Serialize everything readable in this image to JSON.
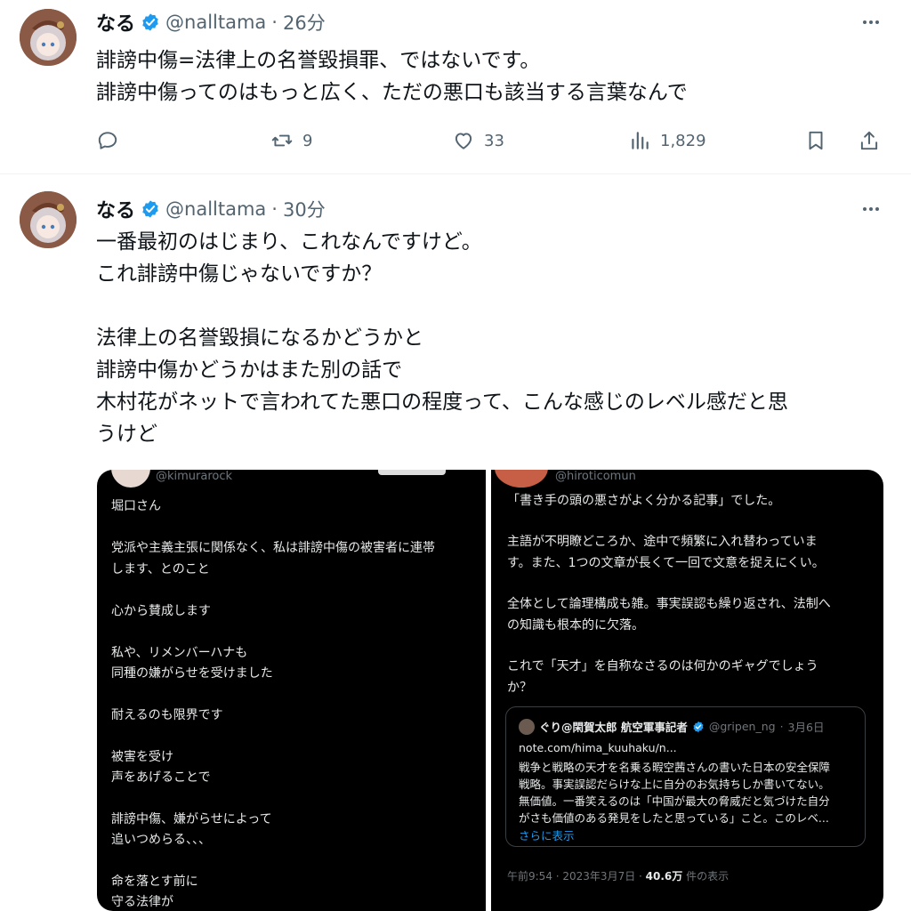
{
  "tweets": [
    {
      "name": "なる",
      "handle": "@nalltama",
      "separator": "·",
      "time": "26分",
      "lines": [
        "誹謗中傷=法律上の名誉毀損罪、ではないです。",
        "誹謗中傷ってのはもっと広く、ただの悪口も該当する言葉なんで"
      ],
      "actions": {
        "reply": "",
        "retweet": "9",
        "like": "33",
        "views": "1,829"
      }
    },
    {
      "name": "なる",
      "handle": "@nalltama",
      "separator": "·",
      "time": "30分",
      "lines": [
        "一番最初のはじまり、これなんですけど。",
        "これ誹謗中傷じゃないですか？",
        "",
        "法律上の名誉毀損になるかどうかと",
        "誹謗中傷かどうかはまた別の話で",
        "木村花がネットで言われてた悪口の程度って、こんな感じのレベル感だと思",
        "うけど"
      ]
    }
  ],
  "media": {
    "left": {
      "handle": "@kimurarock",
      "lines": [
        "堀口さん",
        "",
        "党派や主義主張に関係なく、私は誹謗中傷の被害者に連帯",
        "します、とのこと",
        "",
        "心から賛成します",
        "",
        "私や、リメンバーハナも",
        "同種の嫌がらせを受けました",
        "",
        "耐えるのも限界です",
        "",
        "被害を受け",
        "声をあげることで",
        "",
        "誹謗中傷、嫌がらせによって",
        "追いつめらる、、、",
        "",
        "命を落とす前に",
        "守る法律が"
      ]
    },
    "right": {
      "handle": "@hiroticomun",
      "lines": [
        "「書き手の頭の悪さがよく分かる記事」でした。",
        "",
        "主語が不明瞭どころか、途中で頻繁に入れ替わっていま",
        "す。また、1つの文章が長くて一回で文意を捉えにくい。",
        "",
        "全体として論理構成も雑。事実誤認も繰り返され、法制へ",
        "の知識も根本的に欠落。",
        "",
        "これで「天才」を自称なさるのは何かのギャグでしょう",
        "か？"
      ],
      "quote": {
        "name": "ぐり@閑賀太郎 航空軍事記者",
        "handle": "@gripen_ng",
        "separator": "·",
        "date": "3月6日",
        "lines": [
          "note.com/hima_kuuhaku/n...",
          "戦争と戦略の天才を名乗る暇空茜さんの書いた日本の安全保障",
          "戦略。事実誤認だらけな上に自分のお気持ちしか書いてない。",
          "無価値。一番笑えるのは「中国が最大の脅威だと気づけた自分",
          "がさも価値のある発見をしたと思っている」こと。このレベ..."
        ],
        "show_more": "さらに表示"
      },
      "meta_time": "午前9:54 · 2023年3月7日 · ",
      "meta_views": "40.6万",
      "meta_suffix": " 件の表示"
    }
  },
  "icons": {
    "verified_color": "#1d9bf0",
    "action_color": "#536471"
  }
}
